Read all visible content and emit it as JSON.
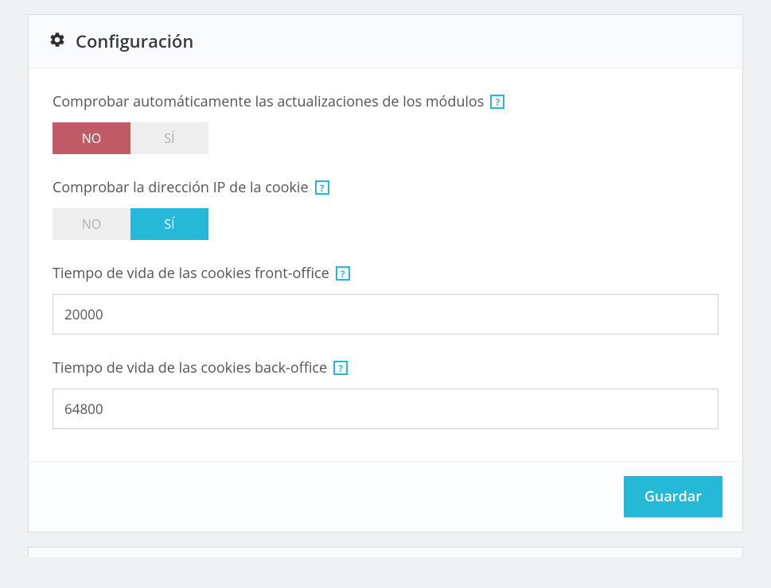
{
  "panel": {
    "title": "Configuración"
  },
  "fields": {
    "auto_check_updates": {
      "label": "Comprobar automáticamente las actualizaciones de los módulos",
      "no_label": "NO",
      "si_label": "SÍ"
    },
    "check_cookie_ip": {
      "label": "Comprobar la dirección IP de la cookie",
      "no_label": "NO",
      "si_label": "SÍ"
    },
    "front_cookie_lifetime": {
      "label": "Tiempo de vida de las cookies front-office",
      "value": "20000"
    },
    "back_cookie_lifetime": {
      "label": "Tiempo de vida de las cookies back-office",
      "value": "64800"
    }
  },
  "help_icon_text": "?",
  "save_button_label": "Guardar"
}
